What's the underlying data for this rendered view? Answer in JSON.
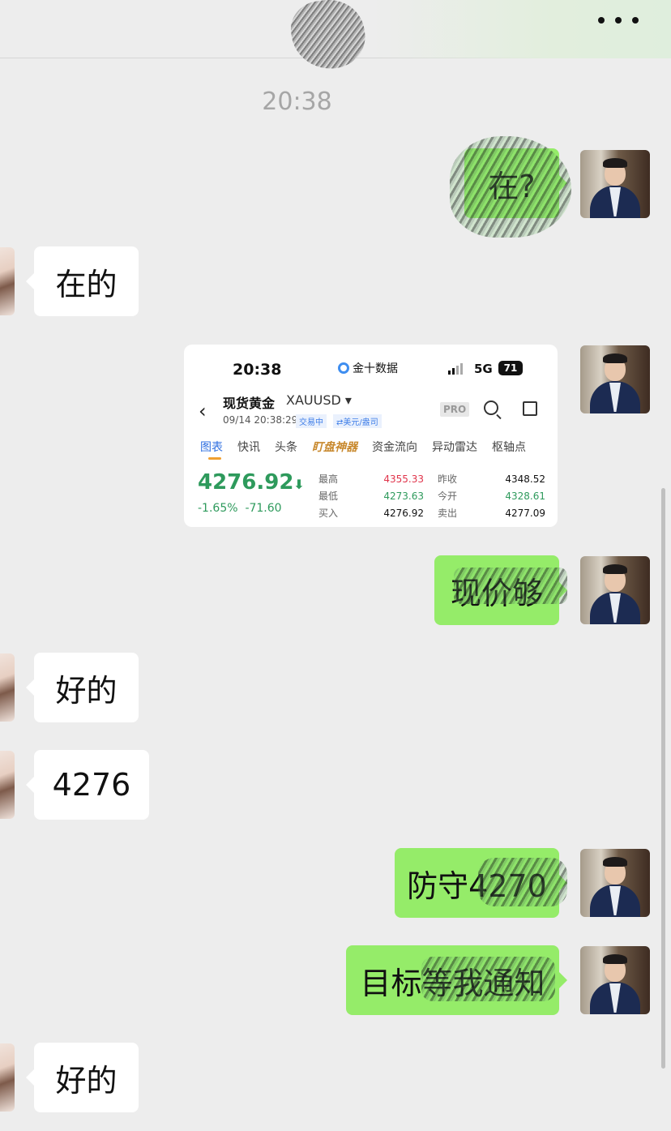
{
  "header": {
    "more_icon": "more-dots-icon"
  },
  "timestamp": "20:38",
  "messages": [
    {
      "side": "right",
      "text": "在?"
    },
    {
      "side": "left",
      "text": "在的"
    },
    {
      "side": "right",
      "type": "image"
    },
    {
      "side": "right",
      "text": "现价够"
    },
    {
      "side": "left",
      "text": "好的"
    },
    {
      "side": "left",
      "text": "4276"
    },
    {
      "side": "right",
      "text": "防守4270"
    },
    {
      "side": "right",
      "text": "目标等我通知"
    },
    {
      "side": "left",
      "text": "好的"
    }
  ],
  "screenshot": {
    "status_time": "20:38",
    "app_name": "金十数据",
    "network": "5G",
    "battery": "71",
    "title": "现货黄金",
    "code": "XAUUSD",
    "datetime": "09/14 20:38:29",
    "tag_trading": "交易中",
    "tag_unit": "⇄美元/盎司",
    "pro": "PRO",
    "tabs": [
      "图表",
      "快讯",
      "头条",
      "盯盘神器",
      "资金流向",
      "异动雷达",
      "枢轴点"
    ],
    "price": "4276.92",
    "change_pct": "-1.65%",
    "change_abs": "-71.60",
    "rows": [
      {
        "k1": "最高",
        "v1": "4355.33",
        "k2": "昨收",
        "v2": "4348.52"
      },
      {
        "k1": "最低",
        "v1": "4273.63",
        "k2": "今开",
        "v2": "4328.61"
      },
      {
        "k1": "买入",
        "v1": "4276.92",
        "k2": "卖出",
        "v2": "4277.09"
      }
    ]
  }
}
